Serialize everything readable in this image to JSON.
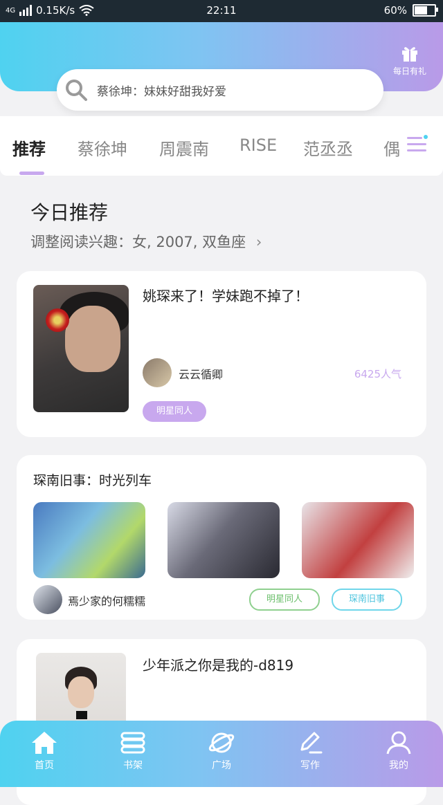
{
  "status": {
    "signal": "4G",
    "speed": "0.15K/s",
    "time": "22:11",
    "battery": "60%",
    "battery_level": 0.6
  },
  "header": {
    "gift_label": "每日有礼"
  },
  "search": {
    "text": "蔡徐坤：妹妹好甜我好爱"
  },
  "tabs": [
    {
      "label": "推荐",
      "active": true
    },
    {
      "label": "蔡徐坤"
    },
    {
      "label": "周震南"
    },
    {
      "label": "RISE"
    },
    {
      "label": "范丞丞"
    },
    {
      "label": "偶"
    }
  ],
  "today": {
    "title": "今日推荐",
    "subtitle": "调整阅读兴趣：女, 2007, 双鱼座"
  },
  "card1": {
    "title": "姚琛来了！学妹跑不掉了！",
    "author": "云云循卿",
    "popularity": "6425人气",
    "tag": "明星同人"
  },
  "card2": {
    "title": "琛南旧事：时光列车",
    "author": "焉少家的何糯糯",
    "tags": [
      "明星同人",
      "琛南旧事"
    ]
  },
  "card3": {
    "title": "少年派之你是我的-d819"
  },
  "nav": [
    {
      "label": "首页",
      "icon": "home-icon"
    },
    {
      "label": "书架",
      "icon": "bookshelf-icon"
    },
    {
      "label": "广场",
      "icon": "planet-icon"
    },
    {
      "label": "写作",
      "icon": "pen-icon"
    },
    {
      "label": "我的",
      "icon": "user-icon"
    }
  ]
}
